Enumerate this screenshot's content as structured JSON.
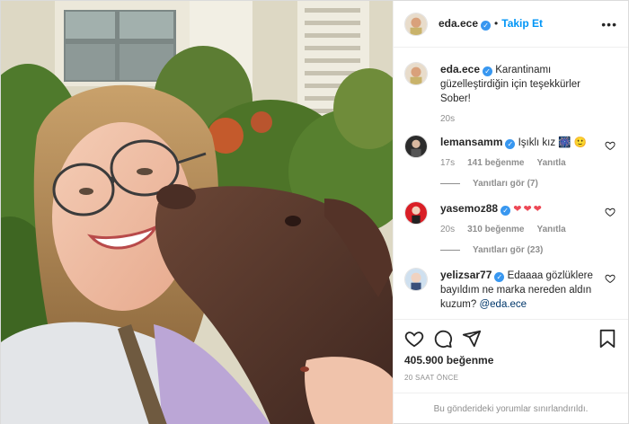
{
  "header": {
    "username": "eda.ece",
    "verified_icon": "verified-badge-icon",
    "separator": "•",
    "follow_label": "Takip Et",
    "more_icon": "more-options-icon"
  },
  "caption": {
    "username": "eda.ece",
    "text": "Karantinamı güzelleştirdiğin için teşekkürler Sober!",
    "time": "20s"
  },
  "comments": [
    {
      "username": "lemansamm",
      "text": "Işıklı kız",
      "emojis": "🎆 🙂",
      "time": "17s",
      "likes": "141 beğenme",
      "reply_label": "Yanıtla",
      "view_replies": "Yanıtları gör (7)"
    },
    {
      "username": "yasemoz88",
      "text": "",
      "emojis": "❤❤❤",
      "time": "20s",
      "likes": "310 beğenme",
      "reply_label": "Yanıtla",
      "view_replies": "Yanıtları gör (23)"
    },
    {
      "username": "yelizsar77",
      "text": "Edaaaa gözlüklere bayıldım ne marka nereden aldın kuzum?",
      "mention": "@eda.ece"
    }
  ],
  "actions": {
    "like_icon": "heart-outline-icon",
    "comment_icon": "comment-bubble-icon",
    "share_icon": "share-paper-plane-icon",
    "save_icon": "bookmark-icon",
    "likes_total": "405.900 beğenme",
    "posted_ago": "20 SAAT ÖNCE",
    "comments_limited": "Bu gönderideki yorumlar sınırlandırıldı."
  },
  "colors": {
    "accent": "#0095f6",
    "verified": "#3897f0",
    "heart_red": "#ed4956",
    "muted": "#8e8e8e"
  }
}
